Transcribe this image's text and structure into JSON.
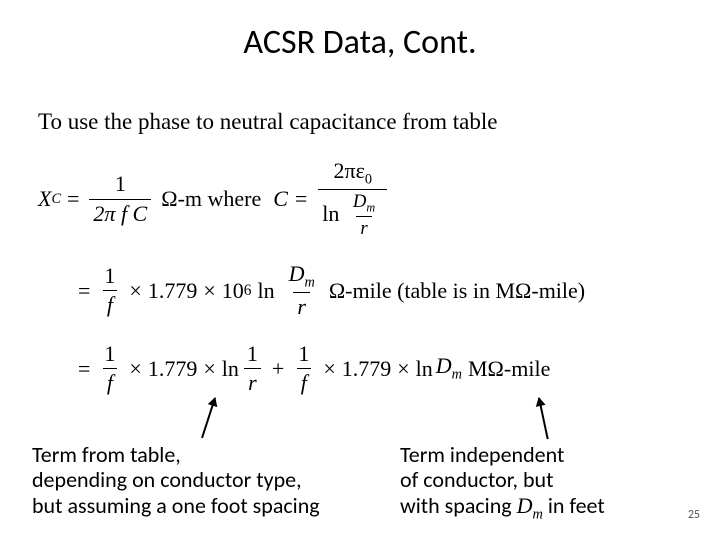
{
  "title": "ACSR Data, Cont.",
  "math": {
    "intro": "To use the phase to neutral capacitance from table",
    "xc": "X",
    "xc_sub": "C",
    "eq": "=",
    "one": "1",
    "twopi_fC": "2π f C",
    "ohm_m_where": "Ω-m where",
    "C_eq": "C =",
    "two_pi_eps": "2πε",
    "eps_sub": "0",
    "ln": "ln",
    "Dm": "D",
    "Dm_sub": "m",
    "r": "r",
    "one_over_f_num": "1",
    "one_over_f_den": "f",
    "times": "×",
    "const": "1.779",
    "tensix": "10",
    "tensix_sup": "6",
    "ohm_mile_note": "Ω-mile (table is in MΩ-mile)",
    "one_over_r_num": "1",
    "one_over_r_den": "r",
    "plus": "+",
    "Momega_mile": "MΩ-mile"
  },
  "captions": {
    "left_l1": "Term from table,",
    "left_l2": "depending on conductor type,",
    "left_l3": "but assuming a one foot spacing",
    "right_l1": "Term independent",
    "right_l2": "of conductor, but",
    "right_l3_a": "with spacing ",
    "right_l3_dm": "D",
    "right_l3_dm_sub": "m",
    "right_l3_b": " in feet"
  },
  "page_number": "25"
}
